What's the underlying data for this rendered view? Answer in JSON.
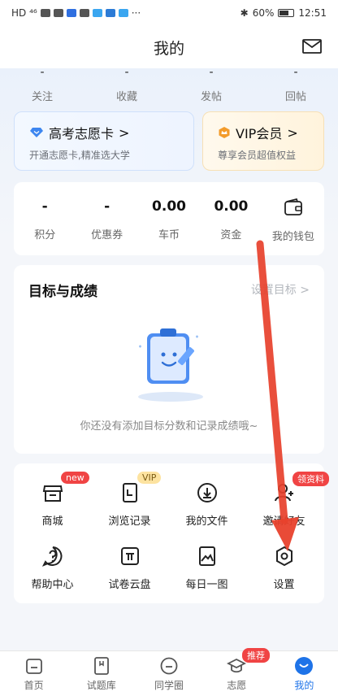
{
  "status_bar": {
    "left_text": "HD ⁴⁶",
    "battery": "60%",
    "time": "12:51"
  },
  "header": {
    "title": "我的"
  },
  "top_stats": [
    {
      "value": "-",
      "label": "关注"
    },
    {
      "value": "-",
      "label": "收藏"
    },
    {
      "value": "-",
      "label": "发帖"
    },
    {
      "value": "-",
      "label": "回帖"
    }
  ],
  "promo": {
    "gaokao": {
      "title": "高考志愿卡",
      "sub": "开通志愿卡,精准选大学"
    },
    "vip": {
      "title": "VIP会员",
      "sub": "尊享会员超值权益"
    },
    "chevron": ">"
  },
  "wallet": [
    {
      "value": "-",
      "label": "积分"
    },
    {
      "value": "-",
      "label": "优惠券"
    },
    {
      "value": "0.00",
      "label": "车币"
    },
    {
      "value": "0.00",
      "label": "资金"
    },
    {
      "label": "我的钱包"
    }
  ],
  "goal": {
    "title": "目标与成绩",
    "set_label": "设置目标",
    "chevron": ">",
    "empty": "你还没有添加目标分数和记录成绩哦~"
  },
  "tools": [
    {
      "label": "商城",
      "icon": "shop-icon",
      "badge": "new"
    },
    {
      "label": "浏览记录",
      "icon": "history-icon",
      "badge": "VIP"
    },
    {
      "label": "我的文件",
      "icon": "download-icon"
    },
    {
      "label": "邀请好友",
      "icon": "invite-icon",
      "badge": "领资料"
    },
    {
      "label": "帮助中心",
      "icon": "help-icon"
    },
    {
      "label": "试卷云盘",
      "icon": "pi-icon"
    },
    {
      "label": "每日一图",
      "icon": "image-icon"
    },
    {
      "label": "设置",
      "icon": "settings-icon"
    }
  ],
  "tabbar": [
    {
      "label": "首页",
      "icon": "home-icon"
    },
    {
      "label": "试题库",
      "icon": "question-bank-icon"
    },
    {
      "label": "同学圈",
      "icon": "community-icon"
    },
    {
      "label": "志愿",
      "icon": "graduation-icon",
      "badge": "推荐"
    },
    {
      "label": "我的",
      "icon": "profile-icon",
      "active": true
    }
  ],
  "colors": {
    "accent": "#1e73e8",
    "annotation_arrow": "#e8412c",
    "badge_red": "#f04444"
  }
}
